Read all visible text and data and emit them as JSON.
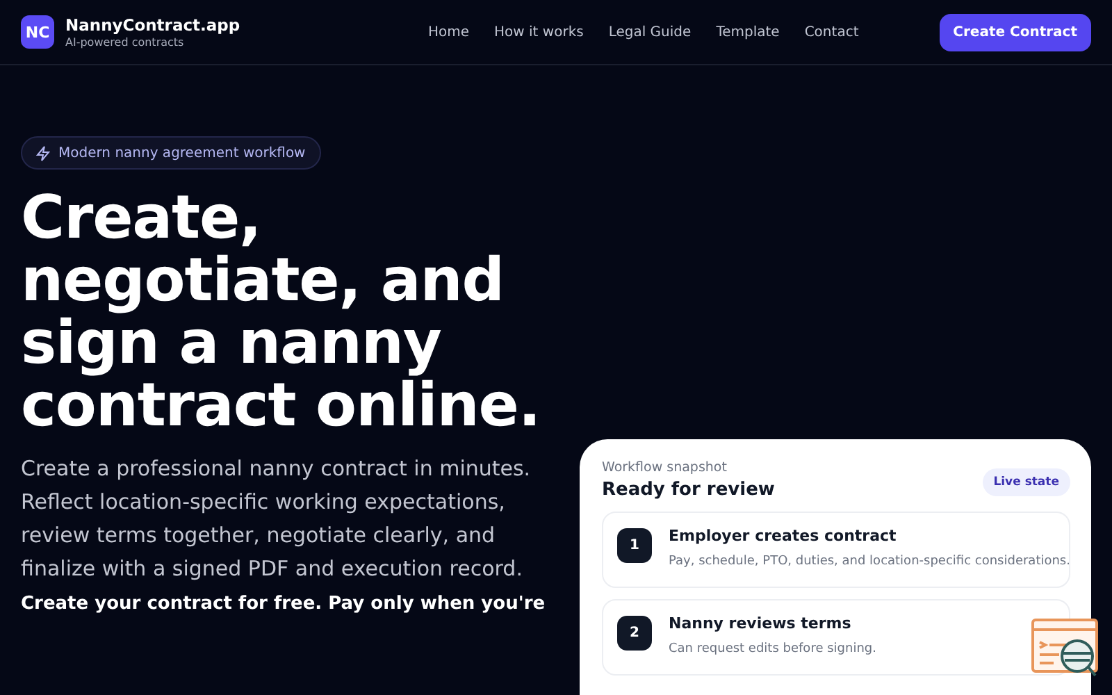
{
  "header": {
    "logo": "NC",
    "brand": "NannyContract.app",
    "tagline": "AI-powered contracts",
    "nav": [
      {
        "label": "Home"
      },
      {
        "label": "How it works"
      },
      {
        "label": "Legal Guide"
      },
      {
        "label": "Template"
      },
      {
        "label": "Contact"
      }
    ],
    "cta": "Create Contract"
  },
  "hero": {
    "badge": "Modern nanny agreement workflow",
    "headline": "Create, negotiate, and sign a nanny contract online.",
    "description": "Create a professional nanny contract in minutes. Reflect location-specific working expectations, review terms together, negotiate clearly, and finalize with a signed PDF and execution record.",
    "pricing_note": "Create your contract for free. Pay only when you're"
  },
  "workflow_card": {
    "label": "Workflow snapshot",
    "title": "Ready for review",
    "status": "Live state",
    "steps": [
      {
        "number": "1",
        "title": "Employer creates contract",
        "description": "Pay, schedule, PTO, duties, and location-specific considerations."
      },
      {
        "number": "2",
        "title": "Nanny reviews terms",
        "description": "Can request edits before signing."
      }
    ]
  }
}
